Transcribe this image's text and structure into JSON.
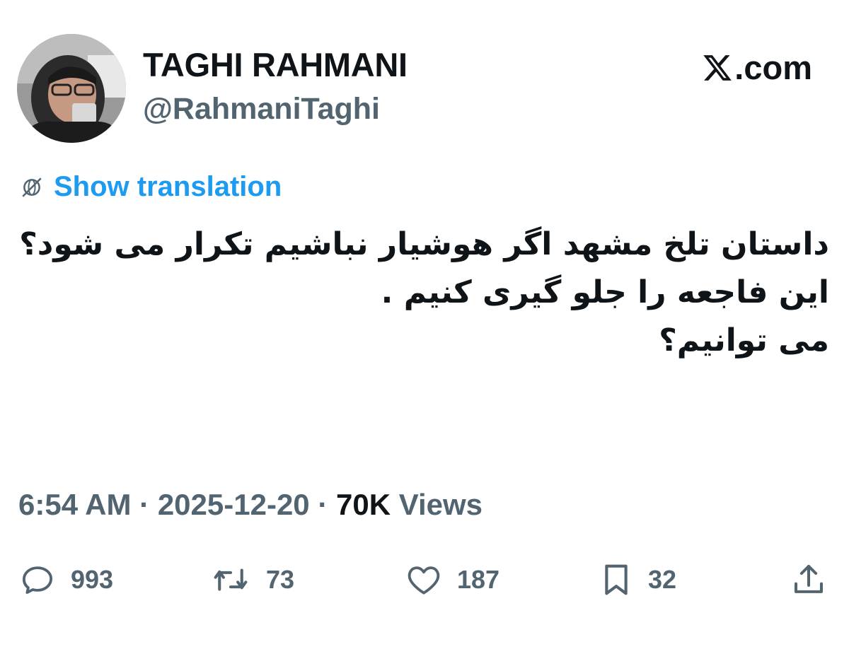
{
  "author": {
    "name": "TAGHI RAHMANI",
    "handle": "@RahmaniTaghi",
    "avatar_icon": "profile-photo"
  },
  "brand": {
    "text": ".com",
    "icon": "x-logo-icon"
  },
  "translation": {
    "label": "Show translation",
    "icon": "globe-strike-icon",
    "color": "#1d9bf0"
  },
  "tweet": {
    "lines": [
      "داستان تلخ مشهد اگر هوشیار نباشیم تکرار می شود؟",
      "این فاجعه را جلو گیری کنیم .",
      "می توانیم؟"
    ]
  },
  "meta": {
    "time": "6:54 AM",
    "separator": " · ",
    "date": "2025-12-20",
    "views_count": "70K",
    "views_label": " Views"
  },
  "actions": {
    "replies": "993",
    "retweets": "73",
    "likes": "187",
    "bookmarks": "32"
  },
  "colors": {
    "text_primary": "#0f1419",
    "text_secondary": "#536471",
    "accent": "#1d9bf0"
  }
}
